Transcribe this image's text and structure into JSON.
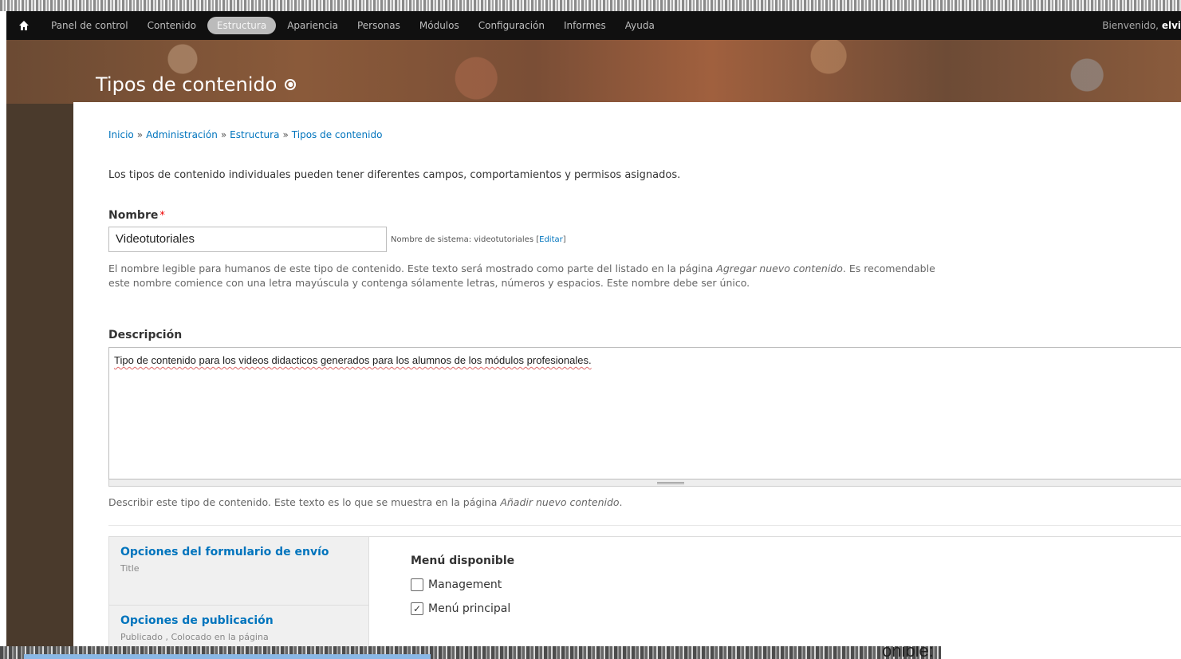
{
  "topbar": {
    "nav": [
      {
        "label": "Panel de control"
      },
      {
        "label": "Contenido"
      },
      {
        "label": "Estructura",
        "active": true
      },
      {
        "label": "Apariencia"
      },
      {
        "label": "Personas"
      },
      {
        "label": "Módulos"
      },
      {
        "label": "Configuración"
      },
      {
        "label": "Informes"
      },
      {
        "label": "Ayuda"
      }
    ],
    "welcome_prefix": "Bienvenido,",
    "welcome_user": "elvi"
  },
  "header": {
    "title": "Tipos de contenido"
  },
  "breadcrumb": [
    "Inicio",
    "Administración",
    "Estructura",
    "Tipos de contenido"
  ],
  "intro": "Los tipos de contenido individuales pueden tener diferentes campos, comportamientos y permisos asignados.",
  "name_field": {
    "label": "Nombre",
    "required_mark": "*",
    "value": "Videotutoriales",
    "machine_prefix": "Nombre de sistema: videotutoriales [",
    "machine_edit": "Editar",
    "machine_suffix": "]",
    "help_a": "El nombre legible para humanos de este tipo de contenido. Este texto será mostrado como parte del listado en la página ",
    "help_em": "Agregar nuevo contenido",
    "help_b": ". Es recomendable",
    "help_c": "este nombre comience con una letra mayúscula y contenga sólamente letras, números y espacios. Este nombre debe ser único."
  },
  "description_field": {
    "label": "Descripción",
    "value": "Tipo de contenido para los videos didacticos generados para los alumnos de los módulos profesionales.",
    "help_a": "Describir este tipo de contenido. Este texto es lo que se muestra en la página ",
    "help_em": "Añadir nuevo contenido",
    "help_b": "."
  },
  "vertical_tabs": [
    {
      "title": "Opciones del formulario de envío",
      "summary": "Title"
    },
    {
      "title": "Opciones de publicación",
      "summary": "Publicado , Colocado en la página"
    }
  ],
  "menu_panel": {
    "title": "Menú disponible",
    "options": [
      {
        "label": "Management",
        "checked": false
      },
      {
        "label": "Menú principal",
        "checked": true
      }
    ]
  },
  "bottom_caption": "onible:"
}
